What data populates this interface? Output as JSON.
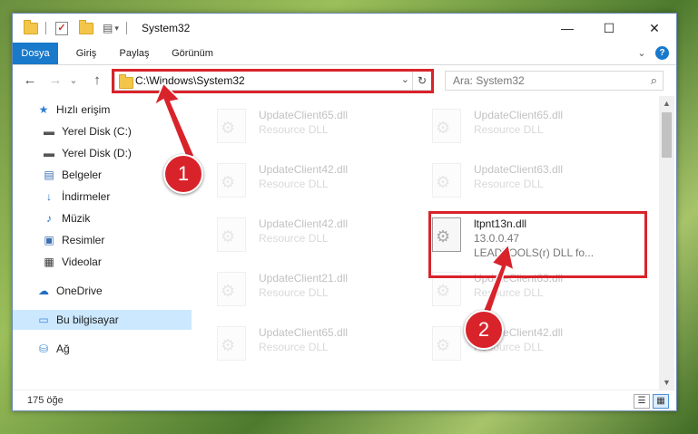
{
  "window": {
    "title": "System32",
    "controls": {
      "minimize": "—",
      "maximize": "☐",
      "close": "✕"
    }
  },
  "quick_access_toolbar": {
    "dropdown": "▾"
  },
  "ribbon": {
    "tabs": [
      "Dosya",
      "Giriş",
      "Paylaş",
      "Görünüm"
    ],
    "collapse": "⌄",
    "help": "?"
  },
  "nav": {
    "back": "←",
    "forward": "→",
    "up": "↑",
    "history": "⌄",
    "address": "C:\\Windows\\System32",
    "address_dropdown": "⌄",
    "refresh": "↻",
    "search_placeholder": "Ara: System32",
    "search_icon": "⌕"
  },
  "sidebar": {
    "items": [
      {
        "label": "Hızlı erişim",
        "icon": "star-icon"
      },
      {
        "label": "Yerel Disk (C:)",
        "icon": "drive-icon",
        "pinned": true
      },
      {
        "label": "Yerel Disk (D:)",
        "icon": "drive-icon"
      },
      {
        "label": "Belgeler",
        "icon": "document-icon",
        "pinned": true
      },
      {
        "label": "İndirmeler",
        "icon": "download-icon",
        "pinned": true
      },
      {
        "label": "Müzik",
        "icon": "music-icon",
        "pinned": true
      },
      {
        "label": "Resimler",
        "icon": "pictures-icon",
        "pinned": true
      },
      {
        "label": "Videolar",
        "icon": "video-icon",
        "pinned": true
      },
      {
        "label": "OneDrive",
        "icon": "cloud-icon"
      },
      {
        "label": "Bu bilgisayar",
        "icon": "computer-icon",
        "selected": true
      },
      {
        "label": "Ağ",
        "icon": "network-icon"
      }
    ],
    "pin_glyph": "📌"
  },
  "files": [
    {
      "name": "UpdateClient65.dll",
      "desc": "Resource DLL"
    },
    {
      "name": "UpdateClient65.dll",
      "desc": "Resource DLL"
    },
    {
      "name": "UpdateClient42.dll",
      "desc": "Resource DLL"
    },
    {
      "name": "UpdateClient63.dll",
      "desc": "Resource DLL"
    },
    {
      "name": "UpdateClient42.dll",
      "desc": "Resource DLL"
    },
    {
      "name": "ltpnt13n.dll",
      "desc": "13.0.0.47",
      "desc2": "LEADTOOLS(r) DLL fo...",
      "highlighted": true
    },
    {
      "name": "UpdateClient21.dll",
      "desc": "Resource DLL"
    },
    {
      "name": "UpdateClient63.dll",
      "desc": "Resource DLL"
    },
    {
      "name": "UpdateClient65.dll",
      "desc": "Resource DLL"
    },
    {
      "name": "UpdateClient42.dll",
      "desc": "Resource DLL"
    }
  ],
  "scrollbar": {
    "up": "▲",
    "down": "▼"
  },
  "status": {
    "item_count": "175 öğe",
    "details_view": "☰",
    "tiles_view": "▦"
  },
  "annotations": {
    "step1": "1",
    "step2": "2",
    "color": "#d9232b"
  }
}
